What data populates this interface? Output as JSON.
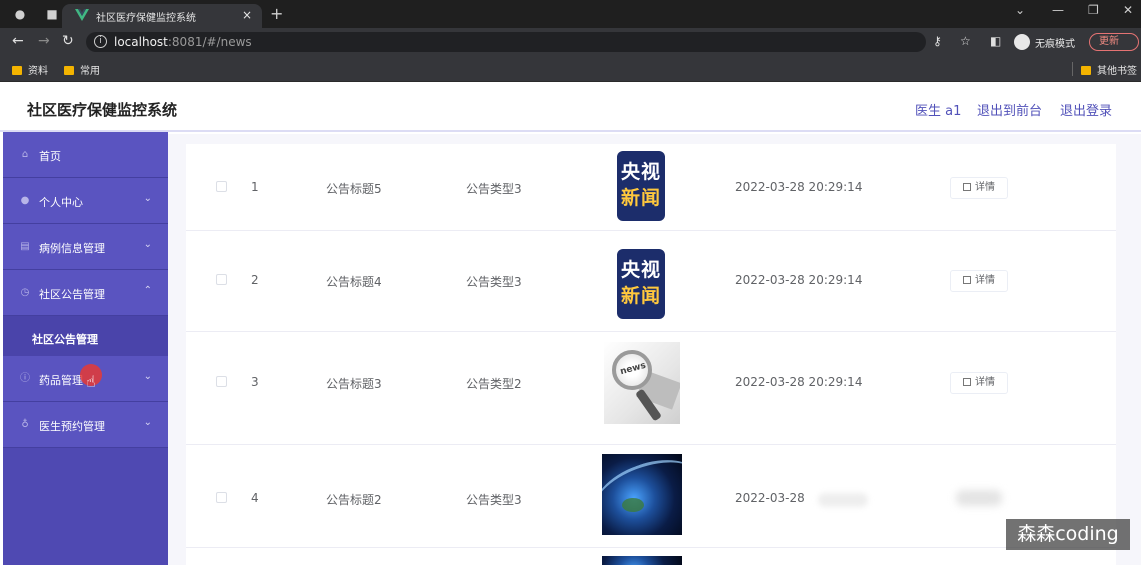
{
  "browser": {
    "tab_title": "社区医疗保健监控系统",
    "tab_close": "×",
    "new_tab": "+",
    "url_host": "localhost",
    "url_path": ":8081/#/news",
    "incognito_label": "无痕模式",
    "update_label": "更新",
    "bookmarks": [
      "资料",
      "常用"
    ],
    "other_bookmarks": "其他书签"
  },
  "header": {
    "title": "社区医疗保健监控系统",
    "user": "医生 a1",
    "back_to_front": "退出到前台",
    "logout": "退出登录"
  },
  "sidebar": {
    "items": [
      {
        "label": "首页",
        "icon": "home-icon"
      },
      {
        "label": "个人中心",
        "icon": "user-icon",
        "expanded": false
      },
      {
        "label": "病例信息管理",
        "icon": "file-icon",
        "expanded": false
      },
      {
        "label": "社区公告管理",
        "icon": "clock-icon",
        "expanded": true
      },
      {
        "label": "药品管理",
        "icon": "info-icon",
        "expanded": false
      },
      {
        "label": "医生预约管理",
        "icon": "bulb-icon",
        "expanded": false
      }
    ],
    "submenu": {
      "label": "社区公告管理"
    }
  },
  "table": {
    "detail_label": "详情",
    "rows": [
      {
        "index": "1",
        "title": "公告标题5",
        "type": "公告类型3",
        "image": "cctv-news-logo",
        "date": "2022-03-28 20:29:14"
      },
      {
        "index": "2",
        "title": "公告标题4",
        "type": "公告类型3",
        "image": "cctv-news-logo",
        "date": "2022-03-28 20:29:14"
      },
      {
        "index": "3",
        "title": "公告标题3",
        "type": "公告类型2",
        "image": "news-magnifier",
        "date": "2022-03-28 20:29:14"
      },
      {
        "index": "4",
        "title": "公告标题2",
        "type": "公告类型3",
        "image": "globe",
        "date": "2022-03-28"
      }
    ]
  },
  "images": {
    "cctv_line1": "央视",
    "cctv_line2": "新闻",
    "news_glass_text": "news"
  },
  "watermark": "森森coding"
}
